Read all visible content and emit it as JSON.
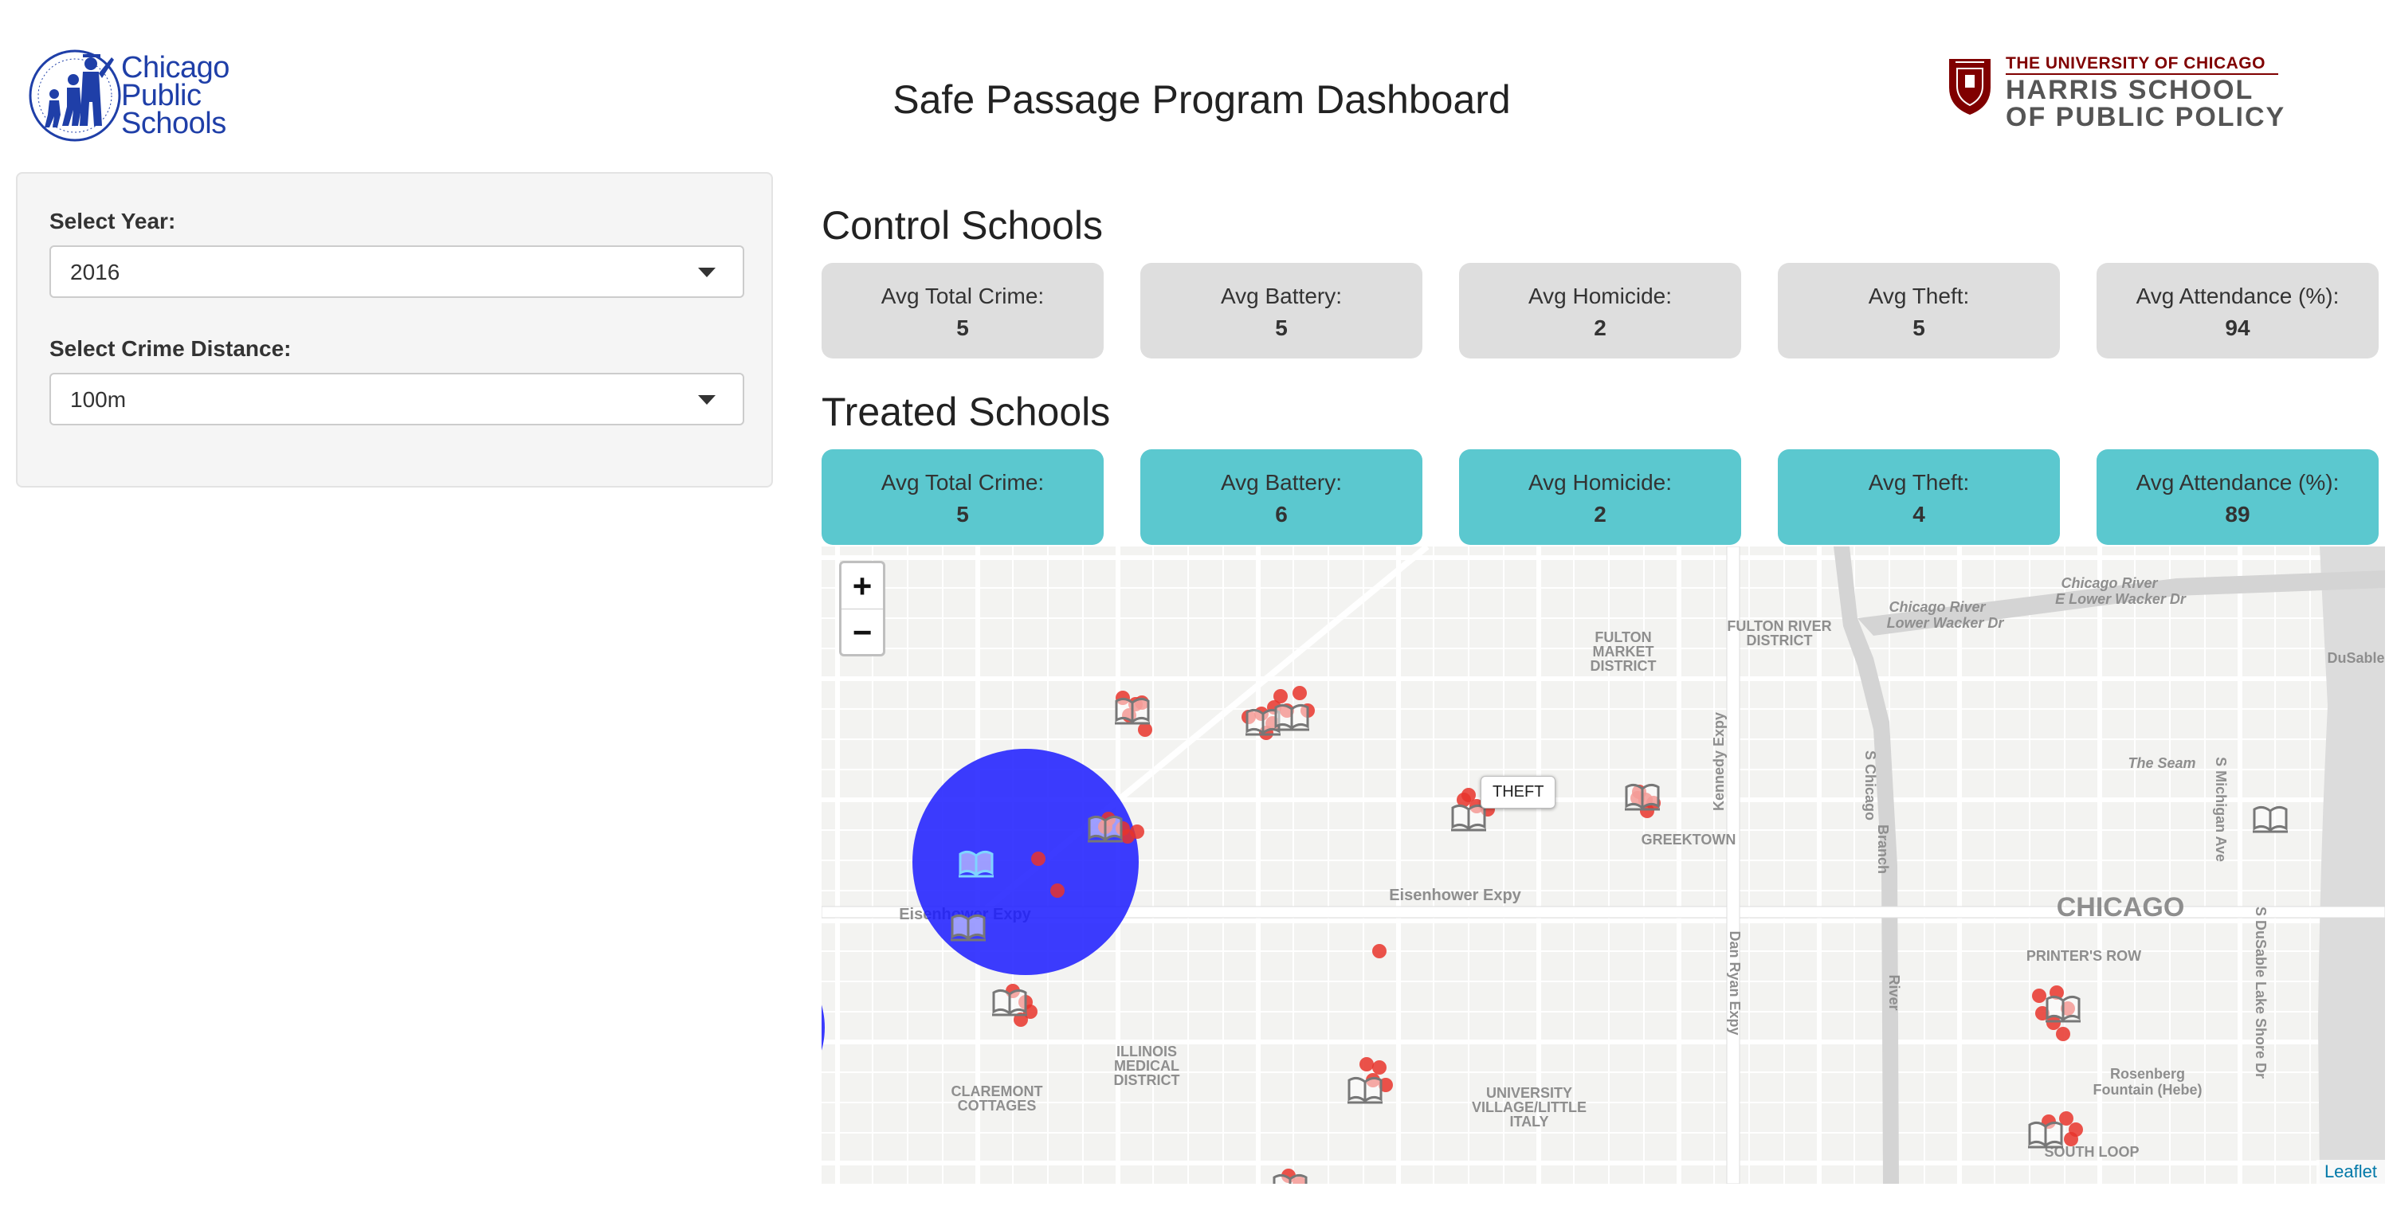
{
  "header": {
    "cps_logo_text": [
      "Chicago",
      "Public",
      "Schools"
    ],
    "title": "Safe Passage Program Dashboard",
    "harris_line1": "THE UNIVERSITY OF CHICAGO",
    "harris_line2": "HARRIS SCHOOL",
    "harris_line3": "OF PUBLIC POLICY"
  },
  "sidebar": {
    "year_label": "Select Year:",
    "year_value": "2016",
    "distance_label": "Select Crime Distance:",
    "distance_value": "100m"
  },
  "control": {
    "title": "Control Schools",
    "stats": [
      {
        "label": "Avg Total Crime:",
        "value": "5"
      },
      {
        "label": "Avg Battery:",
        "value": "5"
      },
      {
        "label": "Avg Homicide:",
        "value": "2"
      },
      {
        "label": "Avg Theft:",
        "value": "5"
      },
      {
        "label": "Avg Attendance (%):",
        "value": "94"
      }
    ]
  },
  "treated": {
    "title": "Treated Schools",
    "stats": [
      {
        "label": "Avg Total Crime:",
        "value": "5"
      },
      {
        "label": "Avg Battery:",
        "value": "6"
      },
      {
        "label": "Avg Homicide:",
        "value": "2"
      },
      {
        "label": "Avg Theft:",
        "value": "4"
      },
      {
        "label": "Avg Attendance (%):",
        "value": "89"
      }
    ]
  },
  "map": {
    "zoom_in": "+",
    "zoom_out": "−",
    "attribution": "Leaflet",
    "tooltip": "THEFT",
    "labels": {
      "fulton_market": [
        "FULTON",
        "MARKET",
        "DISTRICT"
      ],
      "fulton_river": [
        "FULTON RIVER",
        "DISTRICT"
      ],
      "greektown": "GREEKTOWN",
      "eisenhower": "Eisenhower Expy",
      "eisenhower_west": "Eisenhower Expy",
      "chicago": "CHICAGO",
      "printers_row": "PRINTER'S ROW",
      "illinois_medical": [
        "ILLINOIS",
        "MEDICAL",
        "DISTRICT"
      ],
      "claremont": [
        "CLAREMONT",
        "COTTAGES"
      ],
      "university_village": [
        "UNIVERSITY",
        "VILLAGE/LITTLE",
        "ITALY"
      ],
      "south_loop": "SOUTH LOOP",
      "the_seam": "The Seam",
      "rosenberg": [
        "Rosenberg",
        "Fountain (Hebe)"
      ],
      "chicago_river": [
        "Chicago River",
        "E Lower Wacker Dr"
      ],
      "lower_wacker": [
        "Chicago River",
        "Lower Wacker Dr"
      ],
      "dusable": "DuSable Ho",
      "kennedy": "Kennedy Expy",
      "dan_ryan": "Dan Ryan Expy",
      "s_michigan": "S Michigan Ave",
      "s_dusable": "S DuSable Lake Shore Dr",
      "river_v1": "S Chicago",
      "river_v2": "Branch",
      "river_v3": "River"
    },
    "colors": {
      "buffer": "#1a1aff",
      "crime": "#e8342b",
      "school": "#777777",
      "treated_box": "#5bc8cf",
      "control_box": "#dedede"
    }
  }
}
